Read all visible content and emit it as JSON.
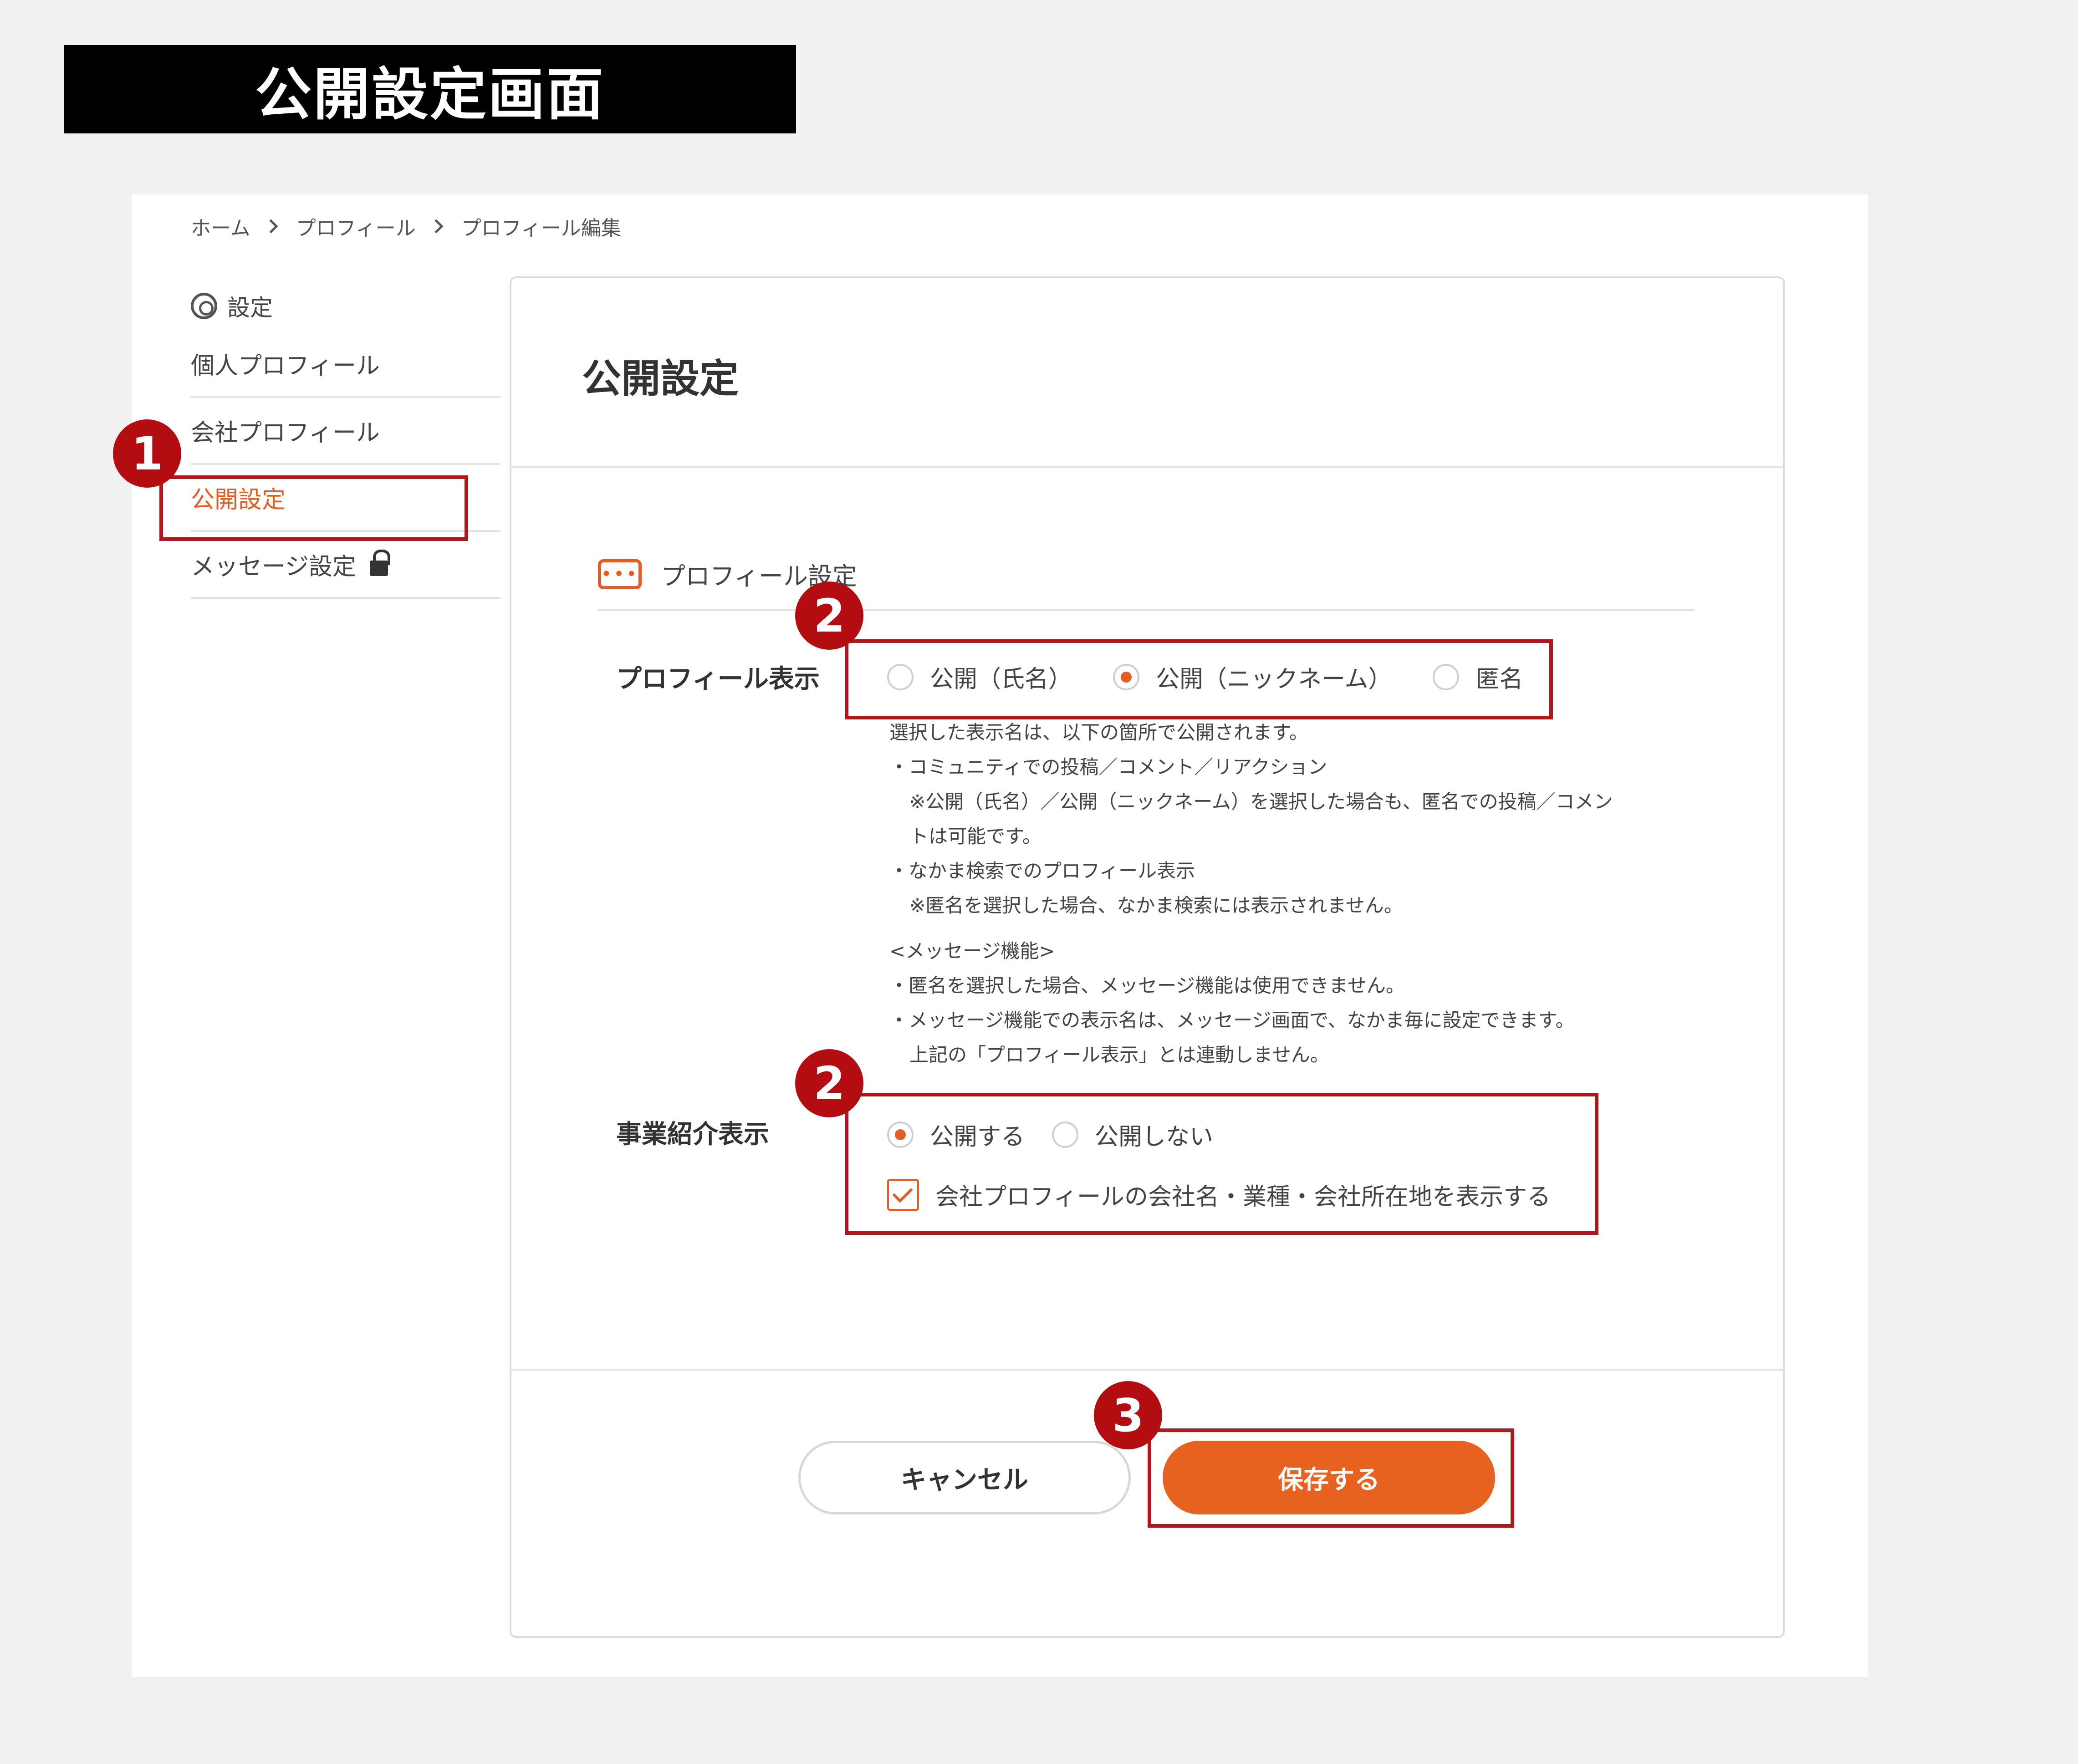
{
  "banner": {
    "title": "公開設定画面"
  },
  "breadcrumb": {
    "items": [
      "ホーム",
      "プロフィール",
      "プロフィール編集"
    ]
  },
  "sidebar": {
    "heading": "設定",
    "items": [
      {
        "label": "個人プロフィール"
      },
      {
        "label": "会社プロフィール"
      },
      {
        "label": "公開設定"
      },
      {
        "label": "メッセージ設定"
      }
    ]
  },
  "panel": {
    "title": "公開設定",
    "section_icon": "chat-bubble-icon",
    "section_title": "プロフィール設定",
    "profile_display": {
      "label": "プロフィール表示",
      "options": [
        "公開（氏名）",
        "公開（ニックネーム）",
        "匿名"
      ],
      "selected": "公開（ニックネーム）"
    },
    "description": [
      "選択した表示名は、以下の箇所で公開されます。",
      "・コミュニティでの投稿／コメント／リアクション",
      "※公開（氏名）／公開（ニックネーム）を選択した場合も、匿名での投稿／コメン",
      "トは可能です。",
      "・なかま検索でのプロフィール表示",
      "※匿名を選択した場合、なかま検索には表示されません。",
      "<メッセージ機能>",
      "・匿名を選択した場合、メッセージ機能は使用できません。",
      "・メッセージ機能での表示名は、メッセージ画面で、なかま毎に設定できます。",
      "上記の「プロフィール表示」とは連動しません。"
    ],
    "business_display": {
      "label": "事業紹介表示",
      "options": [
        "公開する",
        "公開しない"
      ],
      "selected": "公開する",
      "checkbox_label": "会社プロフィールの会社名・業種・会社所在地を表示する",
      "checkbox_checked": true
    },
    "buttons": {
      "cancel": "キャンセル",
      "save": "保存する"
    }
  },
  "annotations": {
    "badge1": "1",
    "badge2": "2",
    "badge3": "3"
  },
  "colors": {
    "accent": "#e8621f",
    "annotation": "#b0171c"
  }
}
